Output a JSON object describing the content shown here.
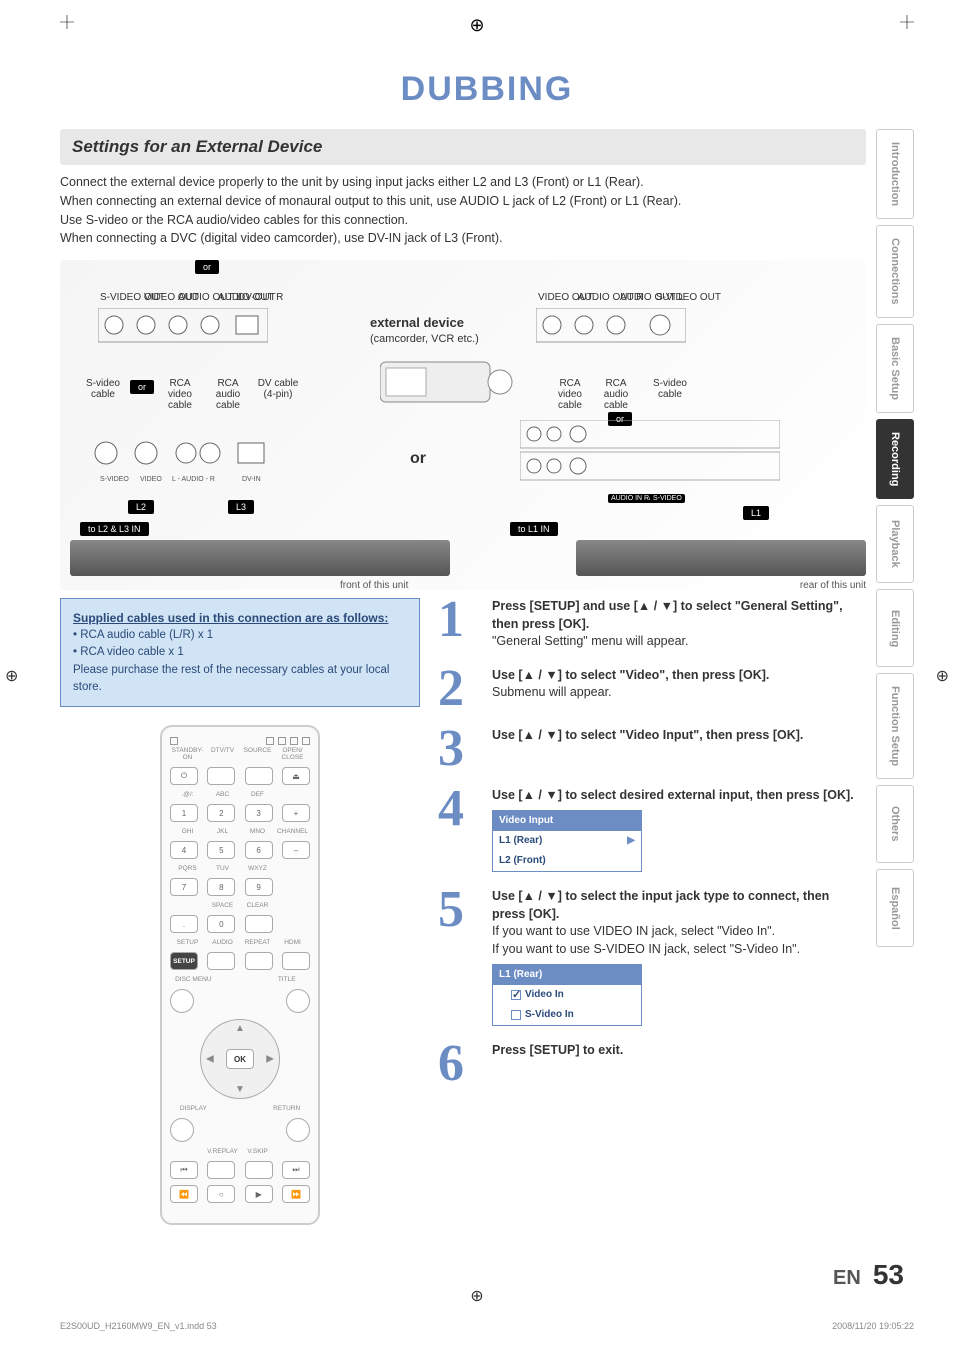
{
  "title": "DUBBING",
  "sectionHead": "Settings for an External Device",
  "intro": [
    "Connect the external device properly to the unit by using input jacks either L2 and L3 (Front) or L1 (Rear).",
    "When connecting an external device of monaural output to this unit, use AUDIO L jack of L2 (Front) or L1 (Rear).",
    "Use S-video or the RCA audio/video cables for this connection.",
    "When connecting a DVC (digital video camcorder), use DV-IN jack of L3 (Front)."
  ],
  "diagram": {
    "or1": "or",
    "jacksLeft": [
      "S-VIDEO OUT",
      "VIDEO OUT",
      "AUDIO OUT L",
      "AUDIO OUT R",
      "DV-OUT"
    ],
    "jacksRight": [
      "VIDEO OUT",
      "AUDIO OUT R",
      "AUDIO OUT L",
      "S-VIDEO OUT"
    ],
    "extDev": "external device",
    "extDevSub": "(camcorder, VCR etc.)",
    "cablesLeft": [
      "S-video cable",
      "RCA video cable",
      "RCA audio cable",
      "DV cable (4-pin)"
    ],
    "cablesRight": [
      "RCA video cable",
      "RCA audio cable",
      "S-video cable"
    ],
    "orSmallL": "or",
    "bigOr": "or",
    "orSmallR": "or",
    "l2": "L2",
    "l3": "L3",
    "l1": "L1",
    "l1Group": [
      "AUDIO IN R/L",
      "S-VIDEO",
      "VIDEO OUT",
      "AUDIO OUT",
      "S-VIDEO"
    ],
    "toL2L3": "to L2 & L3 IN",
    "toL1": "to L1 IN",
    "frontCap": "front of this unit",
    "rearCap": "rear of this unit"
  },
  "blueBox": {
    "hd": "Supplied cables used in this connection are as follows:",
    "l1": "• RCA audio cable (L/R) x 1",
    "l2": "• RCA video cable x 1",
    "l3": "Please purchase the rest of the necessary cables at your local store."
  },
  "remote": {
    "row1": [
      "STANDBY-ON",
      "DTV/TV",
      "SOURCE",
      "OPEN/ CLOSE"
    ],
    "row2lbl": [
      ".@/:",
      "ABC",
      "DEF",
      ""
    ],
    "row2": [
      "1",
      "2",
      "3",
      "+"
    ],
    "row3lbl": [
      "GHI",
      "JKL",
      "MNO",
      "CHANNEL"
    ],
    "row3": [
      "4",
      "5",
      "6",
      "–"
    ],
    "row4lbl": [
      "PQRS",
      "TUV",
      "WXYZ",
      ""
    ],
    "row4": [
      "7",
      "8",
      "9",
      ""
    ],
    "row5lbl": [
      "",
      "SPACE",
      "CLEAR",
      ""
    ],
    "row5": [
      ".",
      "0",
      "",
      ""
    ],
    "row6": [
      "SETUP",
      "AUDIO",
      "REPEAT",
      "HDMI"
    ],
    "discMenu": "DISC MENU",
    "titleBtn": "TITLE",
    "ok": "OK",
    "display": "DISPLAY",
    "return": "RETURN",
    "vreplay": "V.REPLAY",
    "vskip": "V.SKIP"
  },
  "steps": {
    "s1": {
      "n": "1",
      "head": "Press [SETUP] and use [▲ / ▼] to select \"General Setting\", then press [OK].",
      "body": "\"General Setting\" menu will appear."
    },
    "s2": {
      "n": "2",
      "head": "Use [▲ / ▼] to select \"Video\", then press [OK].",
      "body": "Submenu will appear."
    },
    "s3": {
      "n": "3",
      "head": "Use [▲ / ▼] to select \"Video Input\", then press [OK].",
      "body": ""
    },
    "s4": {
      "n": "4",
      "head": "Use [▲ / ▼] to select desired external input, then press [OK].",
      "body": "",
      "osdHead": "Video Input",
      "osdRow1": "L1 (Rear)",
      "osdRow2": "L2 (Front)"
    },
    "s5": {
      "n": "5",
      "head": "Use [▲ / ▼] to select the input jack type to connect, then press [OK].",
      "body1": "If you want to use VIDEO IN jack, select \"Video In\".",
      "body2": " If you want to use S-VIDEO IN jack, select \"S-Video In\".",
      "osdHead": "L1 (Rear)",
      "osdRow1": "Video In",
      "osdRow2": "S-Video In"
    },
    "s6": {
      "n": "6",
      "head": "Press [SETUP] to exit.",
      "body": ""
    }
  },
  "tabs": [
    "Introduction",
    "Connections",
    "Basic Setup",
    "Recording",
    "Playback",
    "Editing",
    "Function Setup",
    "Others",
    "Español"
  ],
  "activeTab": "Recording",
  "footer": {
    "lang": "EN",
    "page": "53"
  },
  "tiny": {
    "left": "E2S00UD_H2160MW9_EN_v1.indd   53",
    "right": "2008/11/20   19:05:22"
  }
}
